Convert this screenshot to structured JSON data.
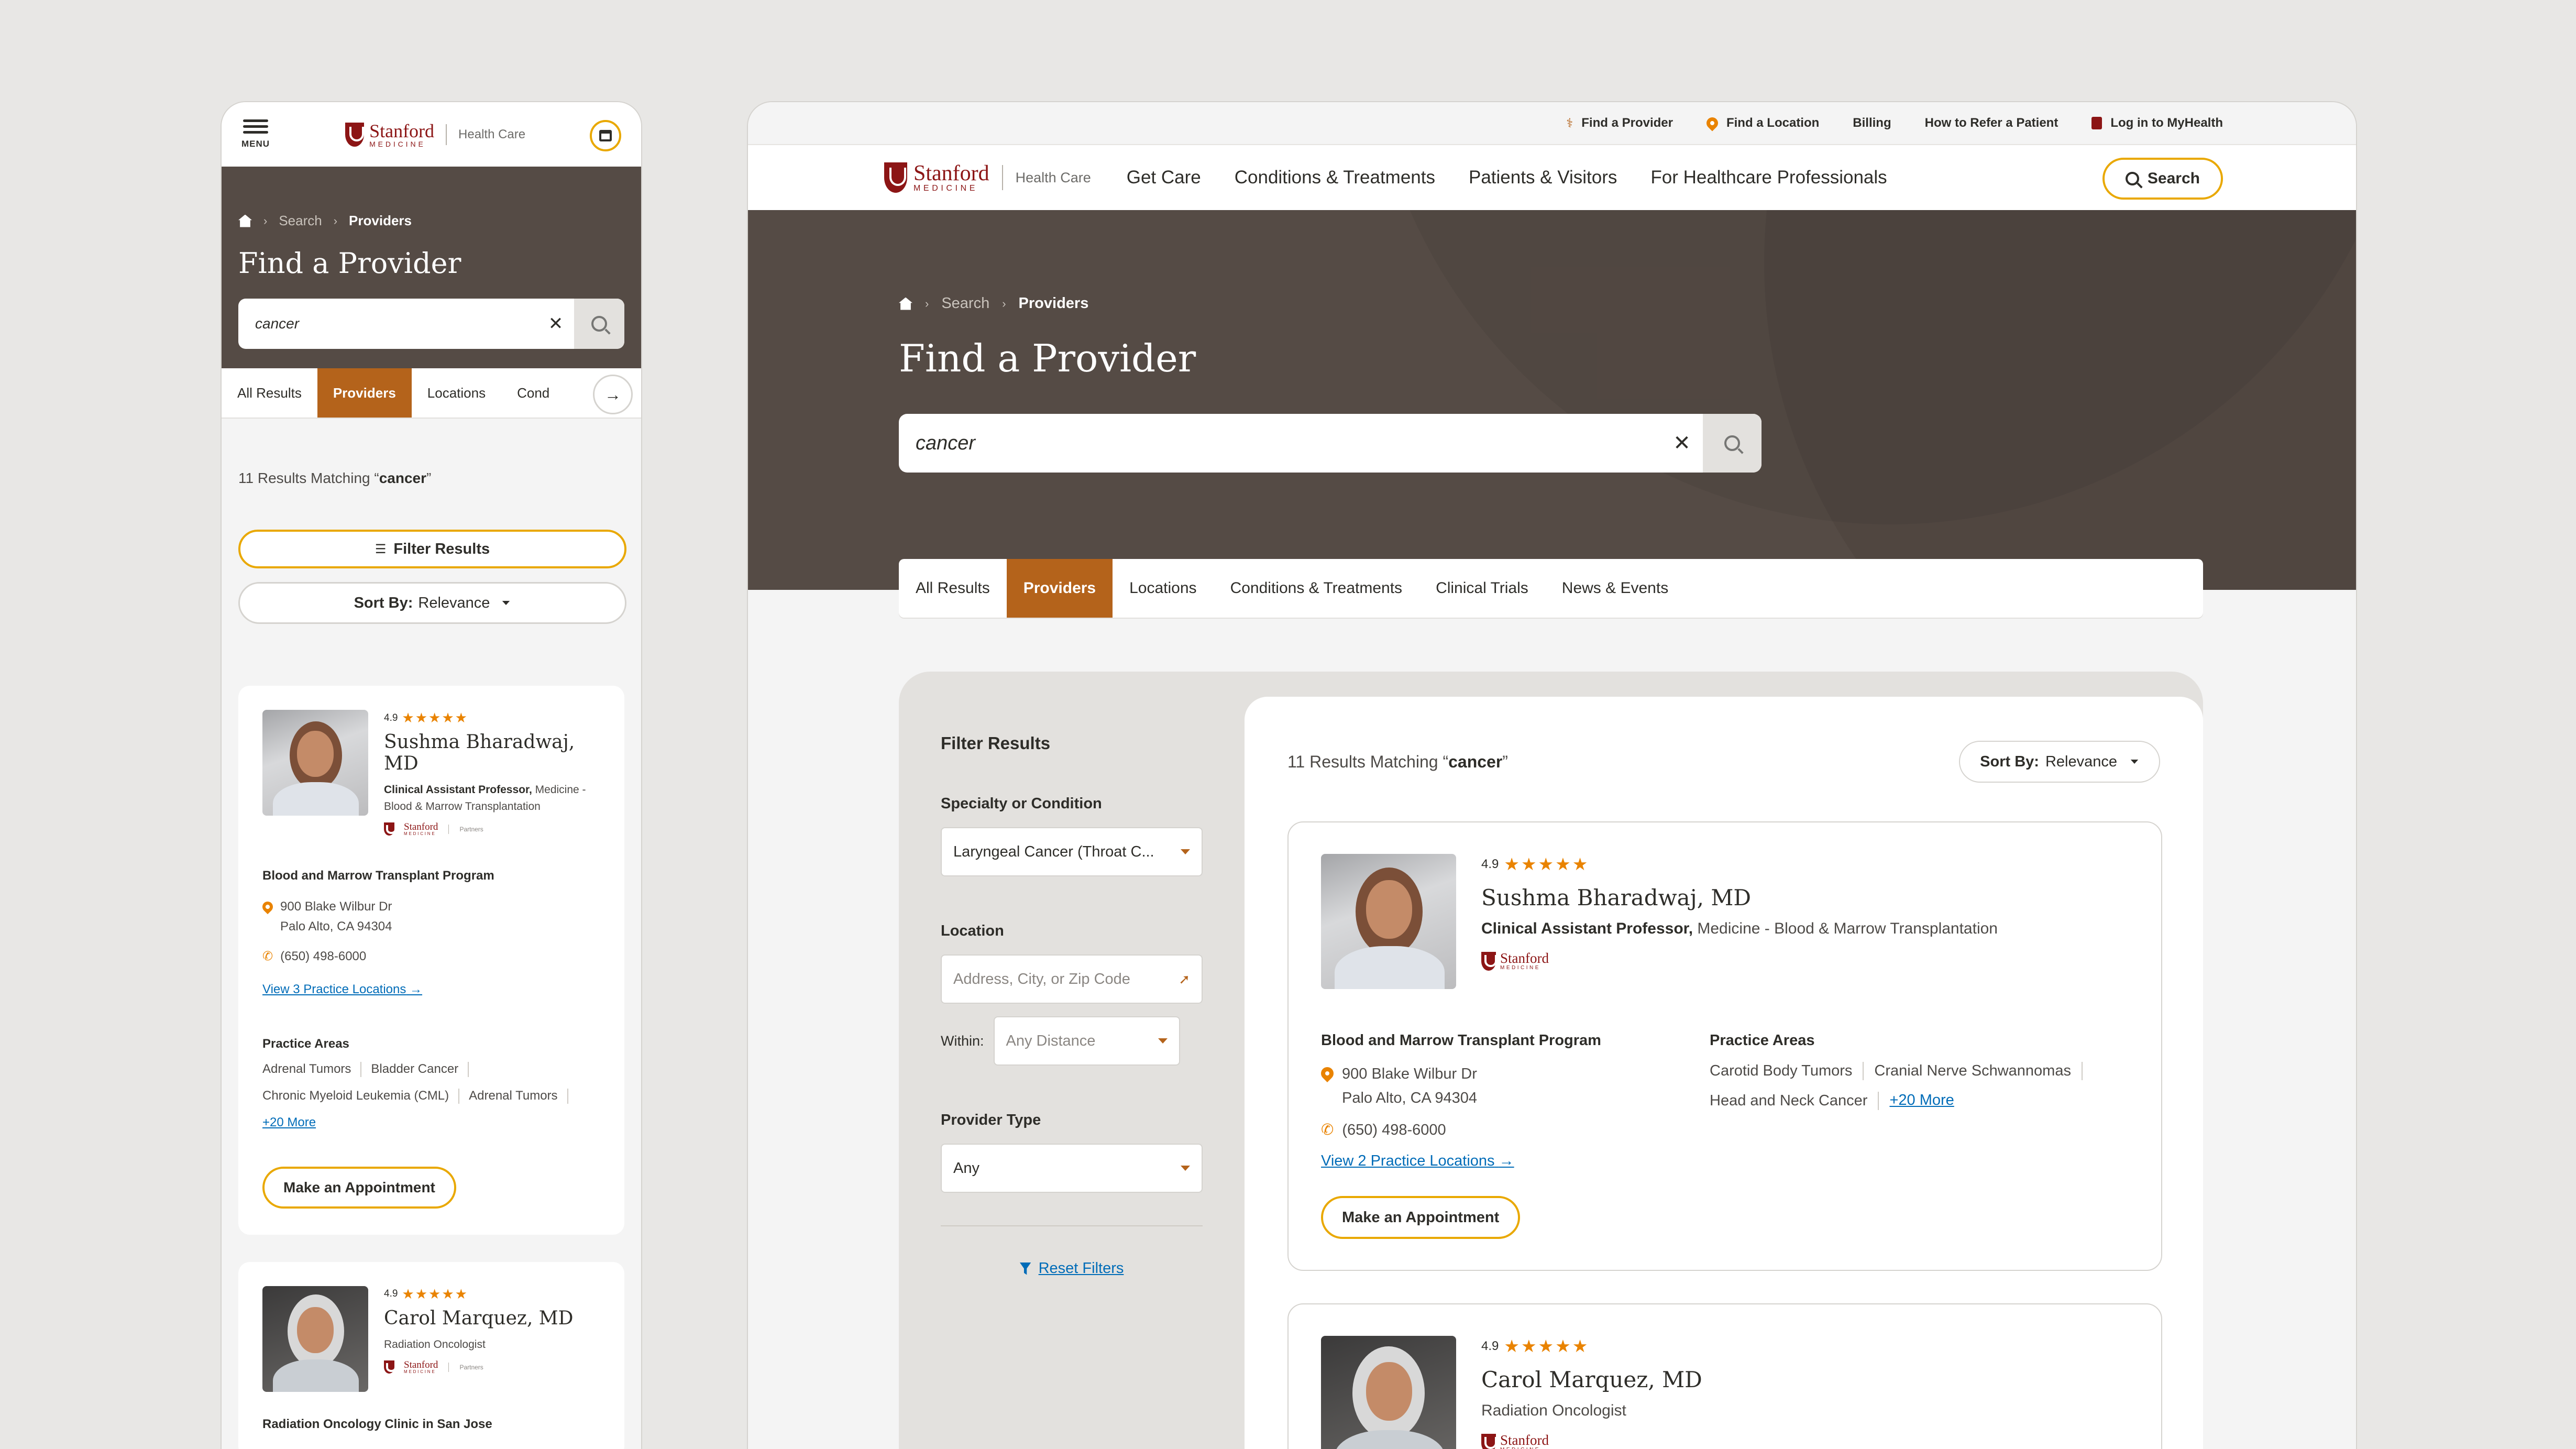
{
  "brand": {
    "top": "Stanford",
    "bottom": "MEDICINE",
    "sub": "Health Care",
    "partners": "Partners"
  },
  "mobile": {
    "menu_label": "MENU",
    "breadcrumb": [
      "Search",
      "Providers"
    ],
    "title": "Find a Provider",
    "search_value": "cancer",
    "tabs": [
      "All Results",
      "Providers",
      "Locations",
      "Cond"
    ],
    "active_tab": "Providers",
    "results_prefix": "11 Results Matching “",
    "results_query": "cancer",
    "results_suffix": "”",
    "filter_label": "Filter Results",
    "sort_label": "Sort By:",
    "sort_value": "Relevance",
    "cards": [
      {
        "rating": "4.9",
        "stars": "★★★★★",
        "name": "Sushma Bharadwaj, MD",
        "title_bold": "Clinical Assistant Professor,",
        "title_rest": " Medicine - Blood & Marrow Transplantation",
        "program": "Blood and Marrow Transplant Program",
        "address1": "900 Blake Wilbur Dr",
        "address2": "Palo Alto, CA 94304",
        "phone": "(650) 498-6000",
        "locations_link": "View 3 Practice Locations",
        "practice_label": "Practice Areas",
        "tags": [
          "Adrenal Tumors",
          "Bladder Cancer",
          "Chronic Myeloid Leukemia (CML)",
          "Adrenal Tumors"
        ],
        "more": "+20 More",
        "appt": "Make an Appointment"
      },
      {
        "rating": "4.9",
        "stars": "★★★★★",
        "name": "Carol Marquez, MD",
        "title": "Radiation Oncologist",
        "program": "Radiation Oncology Clinic in San Jose"
      }
    ]
  },
  "desktop": {
    "utility": [
      "Find a Provider",
      "Find a Location",
      "Billing",
      "How to Refer a Patient",
      "Log in to MyHealth"
    ],
    "nav": [
      "Get Care",
      "Conditions & Treatments",
      "Patients & Visitors",
      "For Healthcare Professionals"
    ],
    "search_button": "Search",
    "breadcrumb": [
      "Search",
      "Providers"
    ],
    "title": "Find a Provider",
    "search_value": "cancer",
    "tabs": [
      "All Results",
      "Providers",
      "Locations",
      "Conditions & Treatments",
      "Clinical Trials",
      "News & Events"
    ],
    "active_tab": "Providers",
    "filters": {
      "heading": "Filter Results",
      "specialty_label": "Specialty or Condition",
      "specialty_value": "Laryngeal Cancer (Throat C...",
      "location_label": "Location",
      "location_placeholder": "Address, City, or Zip Code",
      "within_label": "Within:",
      "within_value": "Any Distance",
      "type_label": "Provider Type",
      "type_value": "Any",
      "reset": "Reset Filters"
    },
    "results_prefix": "11 Results Matching “",
    "results_query": "cancer",
    "results_suffix": "”",
    "sort_label": "Sort By:",
    "sort_value": "Relevance",
    "cards": [
      {
        "rating": "4.9",
        "stars": "★★★★★",
        "name": "Sushma Bharadwaj, MD",
        "title_bold": "Clinical Assistant Professor,",
        "title_rest": " Medicine - Blood & Marrow Transplantation",
        "program": "Blood and Marrow Transplant Program",
        "address1": "900 Blake Wilbur Dr",
        "address2": "Palo Alto, CA 94304",
        "phone": "(650) 498-6000",
        "locations_link": "View 2 Practice Locations",
        "practice_label": "Practice Areas",
        "tags": [
          "Carotid Body Tumors",
          "Cranial Nerve Schwannomas",
          "Head and Neck Cancer"
        ],
        "more": "+20 More",
        "appt": "Make an Appointment"
      },
      {
        "rating": "4.9",
        "stars": "★★★★★",
        "name": "Carol Marquez, MD",
        "title": "Radiation Oncologist"
      }
    ]
  }
}
